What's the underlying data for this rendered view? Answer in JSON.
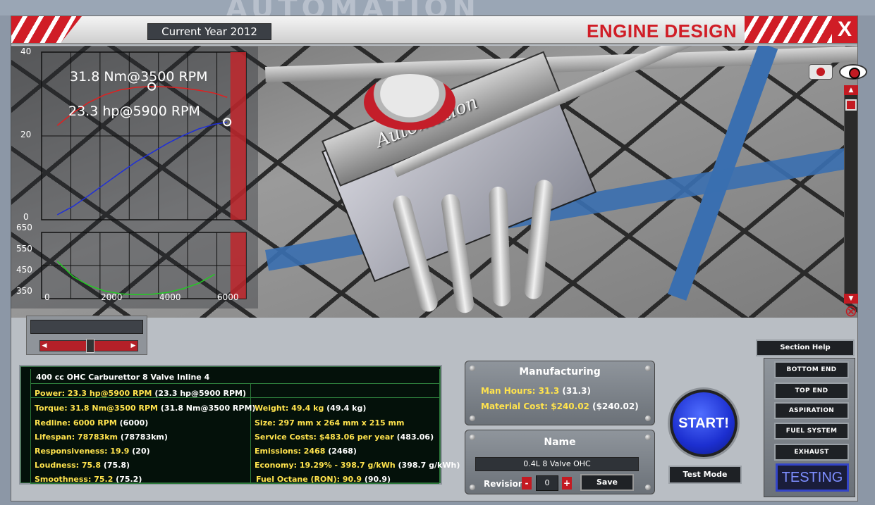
{
  "window": {
    "title": "ENGINE DESIGN",
    "close_label": "X",
    "year_label": "Current Year 2012"
  },
  "viewport": {
    "brand_text": "Automation"
  },
  "graphs": {
    "top": {
      "y_ticks": [
        "40",
        "20",
        "0"
      ],
      "annotation_torque": "31.8 Nm@3500 RPM",
      "annotation_power": "23.3 hp@5900 RPM"
    },
    "bottom": {
      "y_ticks": [
        "650",
        "550",
        "450",
        "350"
      ],
      "x_ticks": [
        "0",
        "2000",
        "4000",
        "6000"
      ]
    }
  },
  "chart_data": [
    {
      "type": "line",
      "xlim": [
        0,
        6500
      ],
      "ylim": [
        0,
        40
      ],
      "redline_x": 6000,
      "series": [
        {
          "color": "#e02020",
          "x": [
            500,
            1000,
            1500,
            2000,
            2500,
            3000,
            3500,
            4000,
            4500,
            5000,
            5500,
            5900
          ],
          "y": [
            22.5,
            25.5,
            28,
            29.8,
            31,
            31.6,
            31.8,
            31.7,
            31.4,
            30.9,
            30.2,
            29.2
          ]
        },
        {
          "color": "#1f2fd8",
          "x": [
            500,
            1000,
            1500,
            2000,
            2500,
            3000,
            3500,
            4000,
            4500,
            5000,
            5500,
            5900
          ],
          "y": [
            1.2,
            3.2,
            5.8,
            8.5,
            11.2,
            13.8,
            16,
            18.2,
            20.1,
            21.7,
            22.8,
            23.3
          ]
        }
      ]
    },
    {
      "type": "line",
      "xlim": [
        0,
        6500
      ],
      "ylim": [
        350,
        650
      ],
      "redline_x": 6000,
      "series": [
        {
          "color": "#22cc22",
          "x": [
            500,
            1000,
            1500,
            2000,
            2500,
            3000,
            3500,
            4000,
            4500,
            5000,
            5500
          ],
          "y": [
            520,
            450,
            410,
            385,
            372,
            368,
            370,
            378,
            395,
            420,
            460
          ]
        }
      ]
    }
  ],
  "stats": {
    "header": "400 cc OHC Carburettor 8 Valve Inline 4",
    "left": [
      {
        "label": "Power: 23.3 hp@5900 RPM",
        "value": " (23.3 hp@5900 RPM)"
      },
      {
        "label": "Torque: 31.8 Nm@3500 RPM",
        "value": " (31.8 Nm@3500 RPM)"
      },
      {
        "label": "Redline: 6000 RPM",
        "value": " (6000)"
      },
      {
        "label": "Lifespan: 78783km",
        "value": " (78783km)"
      },
      {
        "label": "Responsiveness: 19.9",
        "value": " (20)"
      },
      {
        "label": "Loudness: 75.8",
        "value": " (75.8)"
      },
      {
        "label": "Smoothness: 75.2",
        "value": " (75.2)"
      }
    ],
    "right": [
      {
        "label": "Weight: 49.4 kg",
        "value": " (49.4 kg)"
      },
      {
        "label": "Size: 297 mm x 264 mm x 215 mm",
        "value": ""
      },
      {
        "label": "Service Costs: $483.06 per year",
        "value": " (483.06)"
      },
      {
        "label": "Emissions: 2468",
        "value": " (2468)"
      },
      {
        "label": "Economy: 19.29% - 398.7 g/kWh",
        "value": " (398.7 g/kWh)"
      },
      {
        "label": "Fuel Octane (RON): 90.9",
        "value": " (90.9)"
      }
    ]
  },
  "manufacturing": {
    "title": "Manufacturing",
    "man_hours_label": "Man Hours: 31.3",
    "man_hours_value": " (31.3)",
    "material_label": "Material Cost: $240.02",
    "material_value": " ($240.02)"
  },
  "name_box": {
    "title": "Name",
    "value": "0.4L 8 Valve OHC",
    "revision_label": "Revision",
    "revision_value": "0",
    "minus": "-",
    "plus": "+",
    "save_label": "Save"
  },
  "controls": {
    "start_label": "START!",
    "test_mode_label": "Test Mode",
    "section_help_label": "Section Help",
    "testing_label": "TESTING",
    "sections": [
      "BOTTOM END",
      "TOP END",
      "ASPIRATION",
      "FUEL SYSTEM",
      "EXHAUST"
    ]
  }
}
